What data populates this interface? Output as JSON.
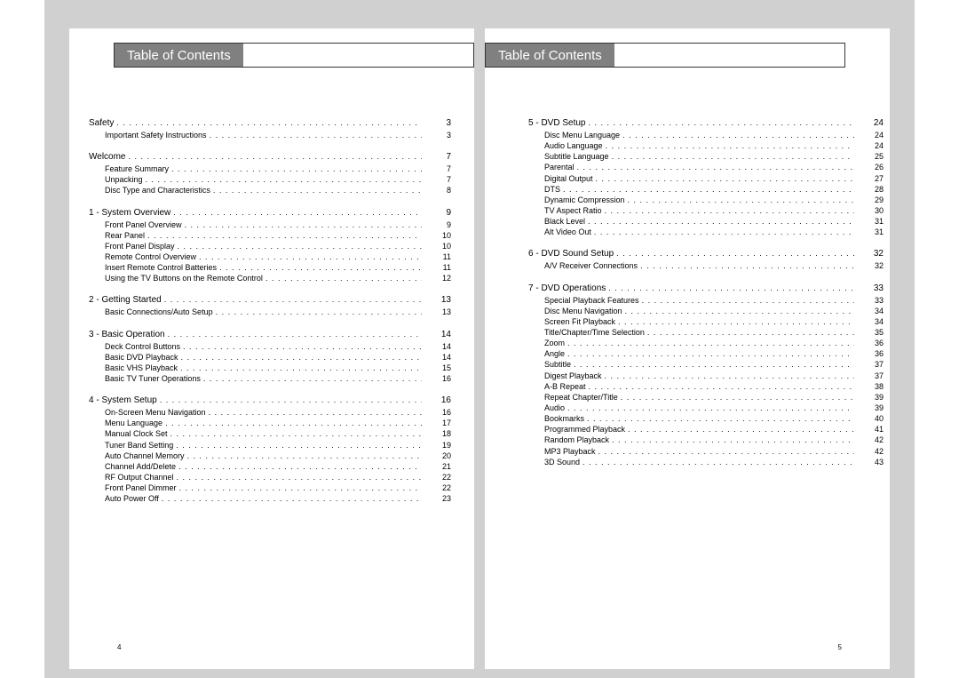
{
  "header_title": "Table of Contents",
  "left_footer": "4",
  "right_footer": "5",
  "left_sections": [
    {
      "title": "Safety",
      "page": "3",
      "items": [
        {
          "t": "Important Safety Instructions",
          "p": "3"
        }
      ]
    },
    {
      "title": "Welcome",
      "page": "7",
      "items": [
        {
          "t": "Feature Summary",
          "p": "7"
        },
        {
          "t": "Unpacking",
          "p": "7"
        },
        {
          "t": "Disc Type and Characteristics",
          "p": "8"
        }
      ]
    },
    {
      "title": "1 - System Overview",
      "page": "9",
      "items": [
        {
          "t": "Front Panel Overview",
          "p": "9"
        },
        {
          "t": "Rear Panel",
          "p": "10"
        },
        {
          "t": "Front Panel Display",
          "p": "10"
        },
        {
          "t": "Remote Control Overview",
          "p": "11"
        },
        {
          "t": "Insert Remote Control Batteries",
          "p": "11"
        },
        {
          "t": "Using the TV Buttons on the Remote Control",
          "p": "12"
        }
      ]
    },
    {
      "title": "2 - Getting Started",
      "page": "13",
      "items": [
        {
          "t": "Basic Connections/Auto Setup",
          "p": "13"
        }
      ]
    },
    {
      "title": "3 - Basic Operation",
      "page": "14",
      "items": [
        {
          "t": "Deck Control Buttons",
          "p": "14"
        },
        {
          "t": "Basic DVD Playback",
          "p": "14"
        },
        {
          "t": "Basic VHS Playback",
          "p": "15"
        },
        {
          "t": "Basic TV Tuner Operations",
          "p": "16"
        }
      ]
    },
    {
      "title": "4 - System Setup",
      "page": "16",
      "items": [
        {
          "t": "On-Screen Menu Navigation",
          "p": "16"
        },
        {
          "t": "Menu Language",
          "p": "17"
        },
        {
          "t": "Manual Clock Set",
          "p": "18"
        },
        {
          "t": "Tuner Band Setting",
          "p": "19"
        },
        {
          "t": "Auto Channel Memory",
          "p": "20"
        },
        {
          "t": "Channel Add/Delete",
          "p": "21"
        },
        {
          "t": "RF Output Channel",
          "p": "22"
        },
        {
          "t": "Front Panel Dimmer",
          "p": "22"
        },
        {
          "t": "Auto Power Off",
          "p": "23"
        }
      ]
    }
  ],
  "right_sections": [
    {
      "title": "5 - DVD Setup",
      "page": "24",
      "items": [
        {
          "t": "Disc Menu Language",
          "p": "24"
        },
        {
          "t": "Audio Language",
          "p": "24"
        },
        {
          "t": "Subtitle Language",
          "p": "25"
        },
        {
          "t": "Parental",
          "p": "26"
        },
        {
          "t": "Digital Output",
          "p": "27"
        },
        {
          "t": "DTS",
          "p": "28"
        },
        {
          "t": "Dynamic Compression",
          "p": "29"
        },
        {
          "t": "TV Aspect Ratio",
          "p": "30"
        },
        {
          "t": "Black Level",
          "p": "31"
        },
        {
          "t": "Alt Video Out",
          "p": "31"
        }
      ]
    },
    {
      "title": "6 - DVD Sound Setup",
      "page": "32",
      "items": [
        {
          "t": "A/V Receiver Connections",
          "p": "32"
        }
      ]
    },
    {
      "title": "7 - DVD Operations",
      "page": "33",
      "items": [
        {
          "t": "Special Playback Features",
          "p": "33"
        },
        {
          "t": "Disc Menu Navigation",
          "p": "34"
        },
        {
          "t": "Screen Fit Playback",
          "p": "34"
        },
        {
          "t": "Title/Chapter/Time Selection",
          "p": "35"
        },
        {
          "t": "Zoom",
          "p": "36"
        },
        {
          "t": "Angle",
          "p": "36"
        },
        {
          "t": "Subtitle",
          "p": "37"
        },
        {
          "t": "Digest Playback",
          "p": "37"
        },
        {
          "t": "A-B Repeat",
          "p": "38"
        },
        {
          "t": "Repeat Chapter/Title",
          "p": "39"
        },
        {
          "t": "Audio",
          "p": "39"
        },
        {
          "t": "Bookmarks",
          "p": "40"
        },
        {
          "t": "Programmed Playback",
          "p": "41"
        },
        {
          "t": "Random Playback",
          "p": "42"
        },
        {
          "t": "MP3 Playback",
          "p": "42"
        },
        {
          "t": "3D Sound",
          "p": "43"
        }
      ]
    }
  ]
}
